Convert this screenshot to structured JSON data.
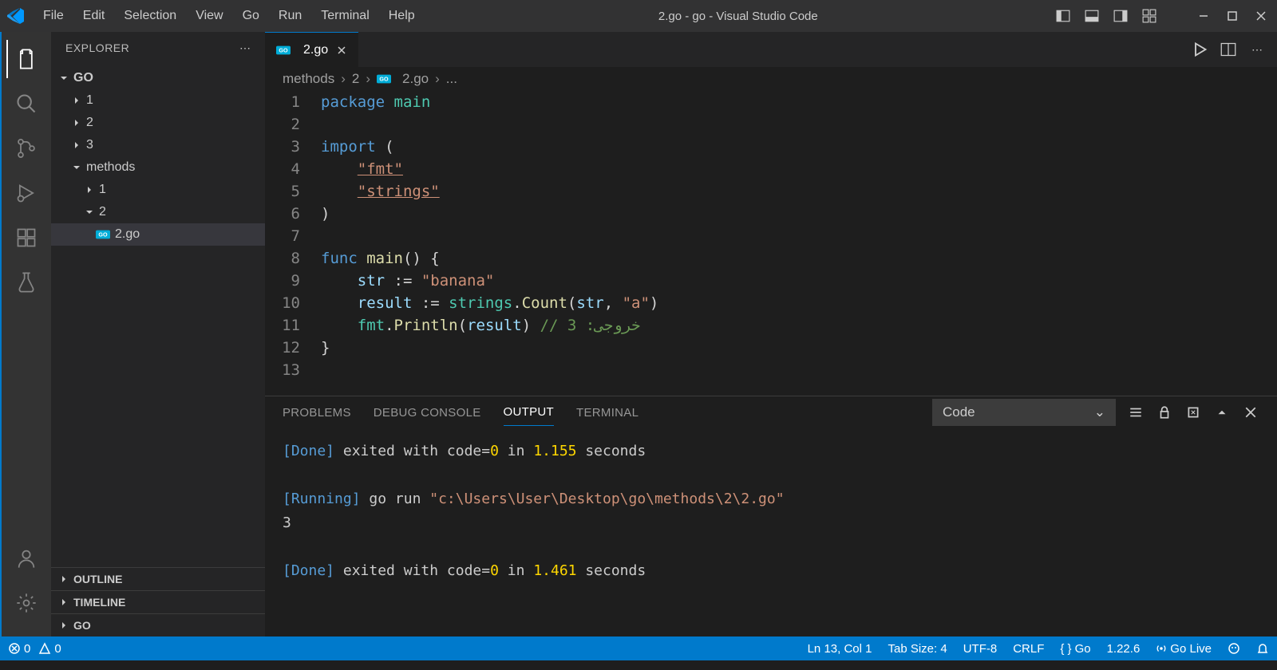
{
  "window": {
    "title": "2.go - go - Visual Studio Code"
  },
  "menu": [
    "File",
    "Edit",
    "Selection",
    "View",
    "Go",
    "Run",
    "Terminal",
    "Help"
  ],
  "sidebar": {
    "title": "EXPLORER",
    "root": "GO",
    "items": [
      "1",
      "2",
      "3"
    ],
    "methods": "methods",
    "m1": "1",
    "m2": "2",
    "file": "2.go",
    "outline": "OUTLINE",
    "timeline": "TIMELINE",
    "go_section": "GO"
  },
  "tab": {
    "name": "2.go"
  },
  "breadcrumb": {
    "p1": "methods",
    "p2": "2",
    "p3": "2.go",
    "p4": "..."
  },
  "code": {
    "l1_kw": "package",
    "l1_name": " main",
    "l3_kw": "import",
    "l3_paren": " (",
    "l4_str": "\"fmt\"",
    "l5_str": "\"strings\"",
    "l6": ")",
    "l8_kw": "func",
    "l8_fn": " main",
    "l8_rest": "() {",
    "l9_v": "str",
    "l9_op": " := ",
    "l9_str": "\"banana\"",
    "l10_v": "result",
    "l10_op": " := ",
    "l10_pkg": "strings",
    "l10_dot": ".",
    "l10_fn": "Count",
    "l10_p1": "(",
    "l10_a1": "str",
    "l10_c": ", ",
    "l10_a2": "\"a\"",
    "l10_p2": ")",
    "l11_pkg": "fmt",
    "l11_dot": ".",
    "l11_fn": "Println",
    "l11_p1": "(",
    "l11_a": "result",
    "l11_p2": ") ",
    "l11_cmt": "// 3 :خروجی",
    "l12": "}"
  },
  "lines": [
    "1",
    "2",
    "3",
    "4",
    "5",
    "6",
    "7",
    "8",
    "9",
    "10",
    "11",
    "12",
    "13"
  ],
  "panel": {
    "tabs": {
      "problems": "PROBLEMS",
      "debug": "DEBUG CONSOLE",
      "output": "OUTPUT",
      "terminal": "TERMINAL"
    },
    "select": "Code"
  },
  "output": {
    "done1_tag": "[Done]",
    "done1_rest": " exited with ",
    "done1_code_label": "code=",
    "done1_code": "0",
    "done1_in": " in ",
    "done1_time": "1.155",
    "done1_sec": " seconds",
    "run_tag": "[Running]",
    "run_cmd": " go run ",
    "run_path": "\"c:\\Users\\User\\Desktop\\go\\methods\\2\\2.go\"",
    "result": "3",
    "done2_tag": "[Done]",
    "done2_rest": " exited with ",
    "done2_code_label": "code=",
    "done2_code": "0",
    "done2_in": " in ",
    "done2_time": "1.461",
    "done2_sec": " seconds"
  },
  "status": {
    "errors": "0",
    "warnings": "0",
    "pos": "Ln 13, Col 1",
    "tab": "Tab Size: 4",
    "enc": "UTF-8",
    "eol": "CRLF",
    "lang": "Go",
    "ver": "1.22.6",
    "live": "Go Live"
  }
}
